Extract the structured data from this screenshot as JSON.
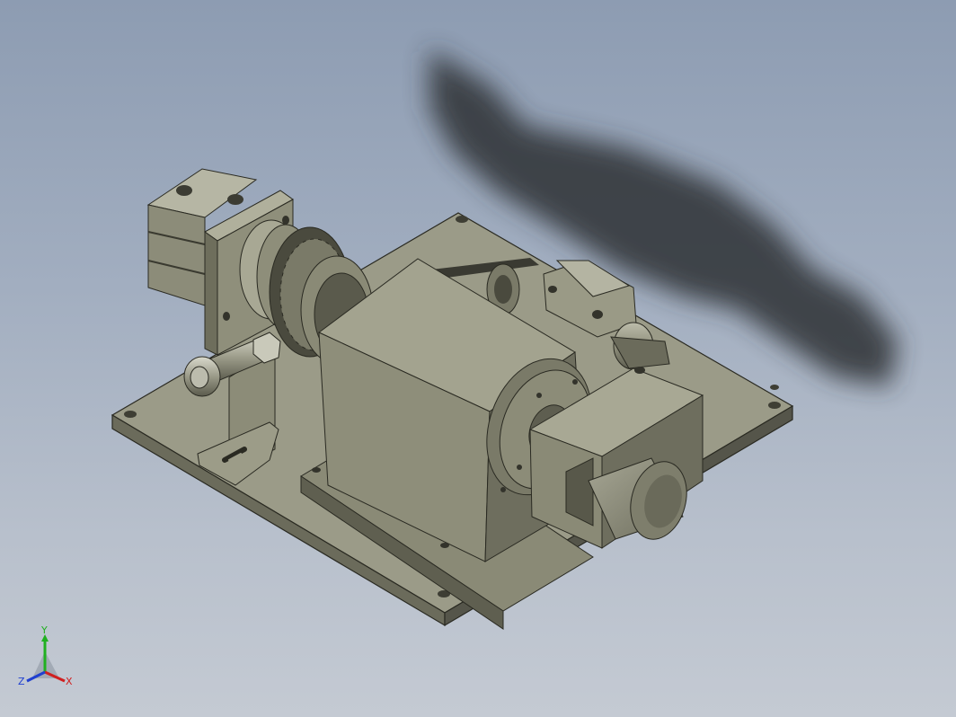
{
  "viewport": {
    "background_top": "#8d9cb2",
    "background_bottom": "#c4cad3",
    "model_color": "#8a8a76"
  },
  "triad": {
    "x_label": "X",
    "y_label": "Y",
    "z_label": "Z",
    "x_color": "#d02020",
    "y_color": "#20b020",
    "z_color": "#2040d0"
  }
}
